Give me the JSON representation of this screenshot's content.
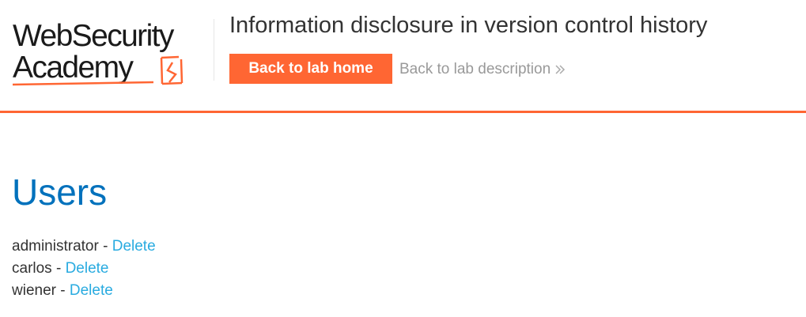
{
  "header": {
    "logo": {
      "line1": "WebSecurity",
      "line2": "Academy",
      "accent_color": "#ff6633"
    },
    "lab_title": "Information disclosure in version control history",
    "back_home_label": "Back to lab home",
    "back_description_label": "Back to lab description",
    "description_arrow_icon": "double-chevron-right-icon",
    "accent_color": "#ff6633"
  },
  "main": {
    "title": "Users",
    "users": [
      {
        "name": "administrator",
        "separator": " - ",
        "action": "Delete"
      },
      {
        "name": "carlos",
        "separator": " - ",
        "action": "Delete"
      },
      {
        "name": "wiener",
        "separator": " - ",
        "action": "Delete"
      }
    ],
    "link_color": "#29abe0",
    "title_color": "#0071bc"
  }
}
